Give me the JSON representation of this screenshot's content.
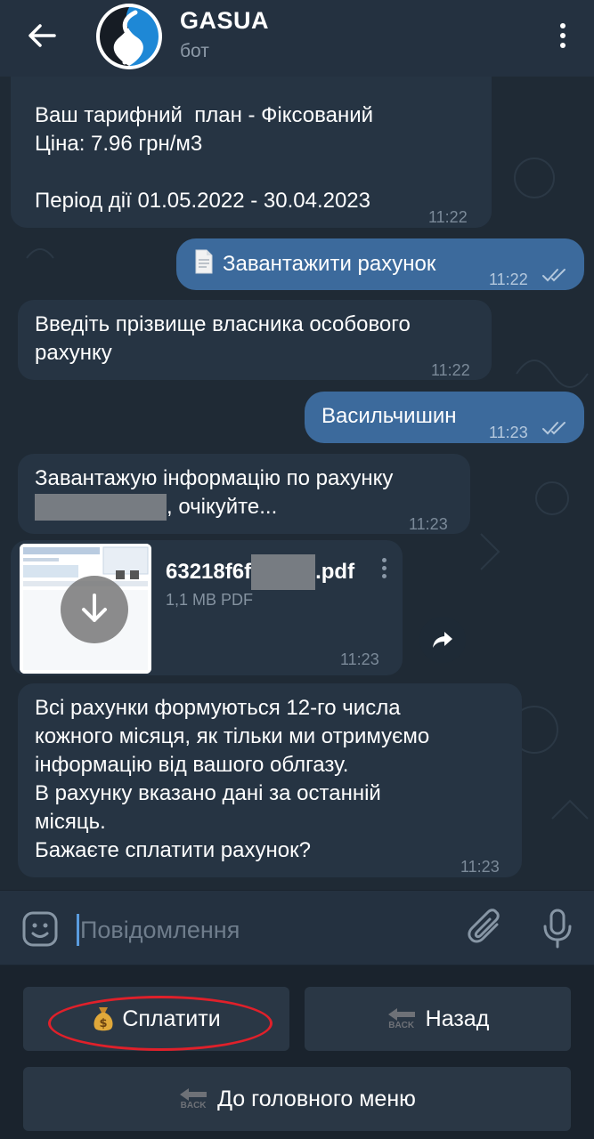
{
  "header": {
    "title": "GASUA",
    "subtitle": "бот"
  },
  "messages": [
    {
      "type": "in",
      "text": "Ваш тарифний  план - Фіксований\nЦіна: 7.96 грн/м3\n\nПеріод дії 01.05.2022 - 30.04.2023",
      "time": "11:22"
    },
    {
      "type": "out",
      "text": "Завантажити рахунок",
      "time": "11:22",
      "icon": "page-facing-up-icon",
      "read": true
    },
    {
      "type": "in",
      "text": "Введіть прізвище власника особового\nрахунку",
      "time": "11:22"
    },
    {
      "type": "out",
      "text": "Васильчишин",
      "time": "11:23",
      "read": true
    },
    {
      "type": "in",
      "text_line1": "Завантажую інформацію по рахунку",
      "text_line2": ", очікуйте...",
      "time": "11:23"
    },
    {
      "type": "in",
      "text": "Всі рахунки формуються 12-го числа\nкожного місяця, як тільки ми отримуємо\nінформацію від вашого облгазу.\nВ рахунку вказано дані за останній\nмісяць.\nБажаєте сплатити рахунок?",
      "time": "11:23"
    }
  ],
  "file": {
    "name_prefix": "63218f6f",
    "name_suffix": ".pdf",
    "meta": "1,1 MB PDF",
    "time": "11:23"
  },
  "input": {
    "placeholder": "Повідомлення"
  },
  "keyboard": {
    "pay": {
      "label": "Сплатити",
      "icon": "money-bag-icon"
    },
    "back": {
      "label": "Назад",
      "icon": "back-arrow-icon",
      "icon_text": "BACK"
    },
    "main_menu": {
      "label": "До головного меню",
      "icon": "back-arrow-icon",
      "icon_text": "BACK"
    }
  },
  "colors": {
    "header_bg": "#243140",
    "chat_bg": "#1f2a35",
    "incoming_bubble": "#263443",
    "outgoing_bubble": "#3c6a9c",
    "keyboard_button": "#2a3745",
    "annotation_red": "#e0202a",
    "accent_blue": "#5a9cde"
  }
}
